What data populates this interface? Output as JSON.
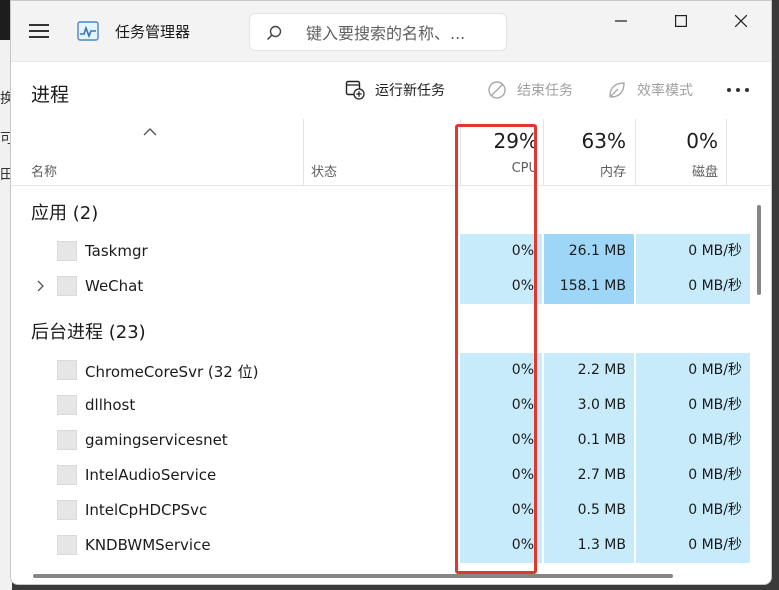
{
  "window": {
    "title": "任务管理器",
    "search_placeholder": "键入要搜索的名称、..."
  },
  "toolbar": {
    "page_title": "进程",
    "run_new_task": "运行新任务",
    "end_task": "结束任务",
    "efficiency_mode": "效率模式"
  },
  "columns": {
    "name": "名称",
    "status": "状态",
    "cpu": {
      "percent": "29%",
      "label": "CPU"
    },
    "memory": {
      "percent": "63%",
      "label": "内存"
    },
    "disk": {
      "percent": "0%",
      "label": "磁盘"
    }
  },
  "groups": [
    {
      "label": "应用 (2)",
      "processes": [
        {
          "name": "Taskmgr",
          "cpu": "0%",
          "memory": "26.1 MB",
          "disk": "0 MB/秒",
          "expandable": false
        },
        {
          "name": "WeChat",
          "cpu": "0%",
          "memory": "158.1 MB",
          "disk": "0 MB/秒",
          "expandable": true
        }
      ]
    },
    {
      "label": "后台进程 (23)",
      "processes": [
        {
          "name": "ChromeCoreSvr (32 位)",
          "cpu": "0%",
          "memory": "2.2 MB",
          "disk": "0 MB/秒",
          "expandable": false
        },
        {
          "name": "dllhost",
          "cpu": "0%",
          "memory": "3.0 MB",
          "disk": "0 MB/秒",
          "expandable": false
        },
        {
          "name": "gamingservicesnet",
          "cpu": "0%",
          "memory": "0.1 MB",
          "disk": "0 MB/秒",
          "expandable": false
        },
        {
          "name": "IntelAudioService",
          "cpu": "0%",
          "memory": "2.7 MB",
          "disk": "0 MB/秒",
          "expandable": false
        },
        {
          "name": "IntelCpHDCPSvc",
          "cpu": "0%",
          "memory": "0.5 MB",
          "disk": "0 MB/秒",
          "expandable": false
        },
        {
          "name": "KNDBWMService",
          "cpu": "0%",
          "memory": "1.3 MB",
          "disk": "0 MB/秒",
          "expandable": false
        }
      ]
    }
  ],
  "background_edge_text": [
    "换",
    "可",
    "田"
  ],
  "colors": {
    "heat_light": "#c7ebfb",
    "heat_strong": "#9dd6f6",
    "highlight": "#e0372e"
  }
}
